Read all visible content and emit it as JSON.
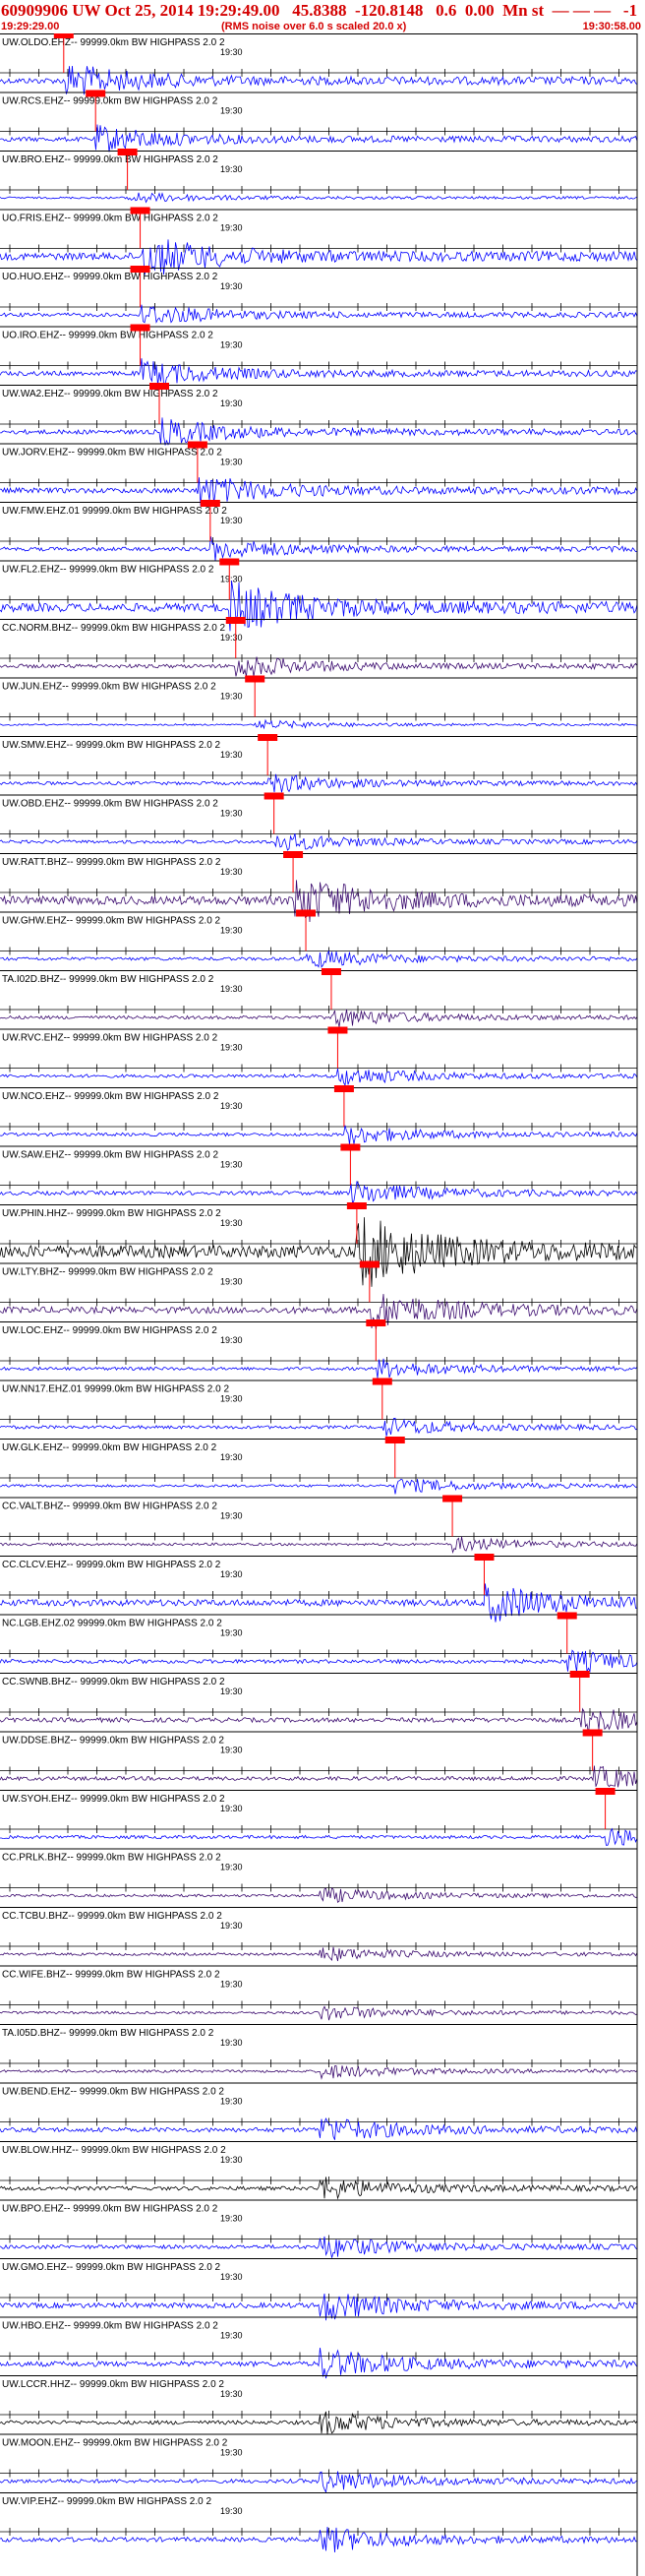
{
  "header": {
    "title": "60909906 UW Oct 25, 2014 19:29:49.00   45.8388  -120.8148   0.6  0.00  Mn st  — — —   -1",
    "start_time": "19:29:29.00",
    "rms_note": "(RMS noise over 6.0 s scaled 20.0 x)",
    "end_time": "19:30:58.00"
  },
  "tick_label": "19:30",
  "colors": {
    "blue": "#0000ff",
    "purple": "#3a0a6e",
    "black": "#000000",
    "pick": "#ff0000",
    "header_red": "#d40000"
  },
  "traces": [
    {
      "label": "UW.OLDO.EHZ-- 99999.0km BW  HIGHPASS  2.0  2",
      "color": "blue",
      "amp": 0.45,
      "pick": 0.1
    },
    {
      "label": "UW.RCS.EHZ-- 99999.0km BW  HIGHPASS  2.0  2",
      "color": "blue",
      "amp": 0.35,
      "pick": 0.15
    },
    {
      "label": "UW.BRO.EHZ-- 99999.0km BW  HIGHPASS  2.0  2",
      "color": "blue",
      "amp": 0.15,
      "pick": 0.2
    },
    {
      "label": "UO.FRIS.EHZ-- 99999.0km BW  HIGHPASS  2.0  2",
      "color": "blue",
      "amp": 0.55,
      "pick": 0.22
    },
    {
      "label": "UO.HUO.EHZ-- 99999.0km BW  HIGHPASS  2.0  2",
      "color": "blue",
      "amp": 0.3,
      "pick": 0.22
    },
    {
      "label": "UO.IRO.EHZ-- 99999.0km BW  HIGHPASS  2.0  2",
      "color": "blue",
      "amp": 0.35,
      "pick": 0.22
    },
    {
      "label": "UW.WA2.EHZ-- 99999.0km BW  HIGHPASS  2.0  2",
      "color": "blue",
      "amp": 0.35,
      "pick": 0.25
    },
    {
      "label": "UW.JORV.EHZ-- 99999.0km BW  HIGHPASS  2.0  2",
      "color": "blue",
      "amp": 0.4,
      "pick": 0.31
    },
    {
      "label": "UW.FMW.EHZ.01 99999.0km BW  HIGHPASS  2.0  2",
      "color": "blue",
      "amp": 0.3,
      "pick": 0.33
    },
    {
      "label": "UW.FL2.EHZ-- 99999.0km BW  HIGHPASS  2.0  2",
      "color": "blue",
      "amp": 0.65,
      "pick": 0.36
    },
    {
      "label": "CC.NORM.BHZ-- 99999.0km BW  HIGHPASS  2.0  2",
      "color": "purple",
      "amp": 0.3,
      "pick": 0.37
    },
    {
      "label": "UW.JUN.EHZ-- 99999.0km BW  HIGHPASS  2.0  2",
      "color": "blue",
      "amp": 0.12,
      "pick": 0.4
    },
    {
      "label": "UW.SMW.EHZ-- 99999.0km BW  HIGHPASS  2.0  2",
      "color": "blue",
      "amp": 0.25,
      "pick": 0.42
    },
    {
      "label": "UW.OBD.EHZ-- 99999.0km BW  HIGHPASS  2.0  2",
      "color": "blue",
      "amp": 0.25,
      "pick": 0.43
    },
    {
      "label": "UW.RATT.BHZ-- 99999.0km BW  HIGHPASS  2.0  2",
      "color": "purple",
      "amp": 0.65,
      "pick": 0.46
    },
    {
      "label": "UW.GHW.EHZ-- 99999.0km BW  HIGHPASS  2.0  2",
      "color": "blue",
      "amp": 0.25,
      "pick": 0.48
    },
    {
      "label": "TA.I02D.BHZ-- 99999.0km BW  HIGHPASS  2.0  2",
      "color": "purple",
      "amp": 0.25,
      "pick": 0.52
    },
    {
      "label": "UW.RVC.EHZ-- 99999.0km BW  HIGHPASS  2.0  2",
      "color": "blue",
      "amp": 0.25,
      "pick": 0.53
    },
    {
      "label": "UW.NCO.EHZ-- 99999.0km BW  HIGHPASS  2.0  2",
      "color": "blue",
      "amp": 0.25,
      "pick": 0.54
    },
    {
      "label": "UW.SAW.EHZ-- 99999.0km BW  HIGHPASS  2.0  2",
      "color": "blue",
      "amp": 0.3,
      "pick": 0.55
    },
    {
      "label": "UW.PHIN.HHZ-- 99999.0km BW  HIGHPASS  2.0  2",
      "color": "black",
      "amp": 0.95,
      "pick": 0.56
    },
    {
      "label": "UW.LTY.BHZ-- 99999.0km BW  HIGHPASS  2.0  2",
      "color": "purple",
      "amp": 0.5,
      "pick": 0.58
    },
    {
      "label": "UW.LOC.EHZ-- 99999.0km BW  HIGHPASS  2.0  2",
      "color": "blue",
      "amp": 0.25,
      "pick": 0.59
    },
    {
      "label": "UW.NN17.EHZ.01 99999.0km BW  HIGHPASS  2.0  2",
      "color": "blue",
      "amp": 0.25,
      "pick": 0.6
    },
    {
      "label": "UW.GLK.EHZ-- 99999.0km BW  HIGHPASS  2.0  2",
      "color": "blue",
      "amp": 0.2,
      "pick": 0.62
    },
    {
      "label": "CC.VALT.BHZ-- 99999.0km BW  HIGHPASS  2.0  2",
      "color": "purple",
      "amp": 0.2,
      "pick": 0.71
    },
    {
      "label": "CC.CLCV.EHZ-- 99999.0km BW  HIGHPASS  2.0  2",
      "color": "blue",
      "amp": 0.5,
      "pick": 0.76
    },
    {
      "label": "NC.LGB.EHZ.02 99999.0km BW  HIGHPASS  2.0  2",
      "color": "blue",
      "amp": 0.3,
      "pick": 0.89
    },
    {
      "label": "CC.SWNB.BHZ-- 99999.0km BW  HIGHPASS  2.0  2",
      "color": "purple",
      "amp": 0.35,
      "pick": 0.91
    },
    {
      "label": "UW.DDSE.BHZ-- 99999.0km BW  HIGHPASS  2.0  2",
      "color": "purple",
      "amp": 0.3,
      "pick": 0.93
    },
    {
      "label": "UW.SYOH.EHZ-- 99999.0km BW  HIGHPASS  2.0  2",
      "color": "blue",
      "amp": 0.25,
      "pick": 0.95
    },
    {
      "label": "CC.PRLK.BHZ-- 99999.0km BW  HIGHPASS  2.0  2",
      "color": "purple",
      "amp": 0.2,
      "pick": null
    },
    {
      "label": "CC.TCBU.BHZ-- 99999.0km BW  HIGHPASS  2.0  2",
      "color": "purple",
      "amp": 0.2,
      "pick": null
    },
    {
      "label": "CC.WIFE.BHZ-- 99999.0km BW  HIGHPASS  2.0  2",
      "color": "purple",
      "amp": 0.2,
      "pick": null
    },
    {
      "label": "TA.I05D.BHZ-- 99999.0km BW  HIGHPASS  2.0  2",
      "color": "purple",
      "amp": 0.2,
      "pick": null
    },
    {
      "label": "UW.BEND.EHZ-- 99999.0km BW  HIGHPASS  2.0  2",
      "color": "blue",
      "amp": 0.35,
      "pick": null
    },
    {
      "label": "UW.BLOW.HHZ-- 99999.0km BW  HIGHPASS  2.0  2",
      "color": "black",
      "amp": 0.3,
      "pick": null
    },
    {
      "label": "UW.BPO.EHZ-- 99999.0km BW  HIGHPASS  2.0  2",
      "color": "blue",
      "amp": 0.3,
      "pick": null
    },
    {
      "label": "UW.GMO.EHZ-- 99999.0km BW  HIGHPASS  2.0  2",
      "color": "blue",
      "amp": 0.4,
      "pick": null
    },
    {
      "label": "UW.HBO.EHZ-- 99999.0km BW  HIGHPASS  2.0  2",
      "color": "blue",
      "amp": 0.4,
      "pick": null
    },
    {
      "label": "UW.LCCR.HHZ-- 99999.0km BW  HIGHPASS  2.0  2",
      "color": "black",
      "amp": 0.3,
      "pick": null
    },
    {
      "label": "UW.MOON.EHZ-- 99999.0km BW  HIGHPASS  2.0  2",
      "color": "blue",
      "amp": 0.3,
      "pick": null
    },
    {
      "label": "UW.VIP.EHZ-- 99999.0km BW  HIGHPASS  2.0  2",
      "color": "blue",
      "amp": 0.35,
      "pick": null
    }
  ]
}
